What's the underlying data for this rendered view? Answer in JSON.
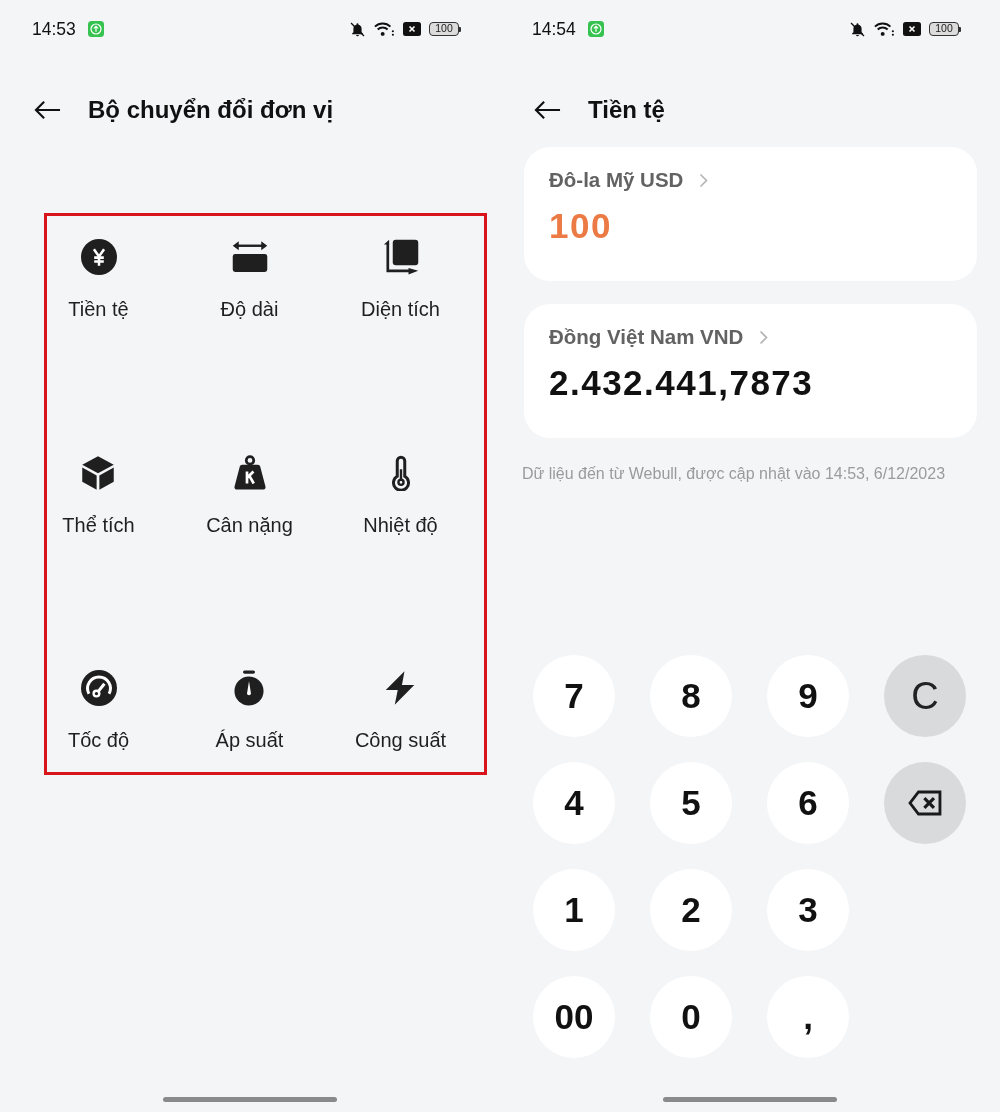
{
  "list_screen": {
    "status_bar": {
      "time": "14:53",
      "battery": "100"
    },
    "title": "Bộ chuyển đổi đơn vị",
    "categories": {
      "highlighted": true,
      "items": [
        {
          "label": "Tiền tệ"
        },
        {
          "label": "Độ dài"
        },
        {
          "label": "Diện tích"
        },
        {
          "label": "Thể tích"
        },
        {
          "label": "Cân nặng"
        },
        {
          "label": "Nhiệt độ"
        },
        {
          "label": "Tốc độ"
        },
        {
          "label": "Áp suất"
        },
        {
          "label": "Công suất"
        }
      ]
    }
  },
  "currency_screen": {
    "status_bar": {
      "time": "14:54",
      "battery": "100"
    },
    "title": "Tiền tệ",
    "currencies": [
      {
        "name": "Đô-la Mỹ USD",
        "amount": "100",
        "selected": true
      },
      {
        "name": "Đồng Việt Nam VND",
        "amount": "2.432.441,7873",
        "selected": false
      }
    ],
    "source_note": "Dữ liệu đến từ Webull, được cập nhật vào 14:53, 6/12/2023",
    "keypad": {
      "rows": [
        [
          {
            "kind": "digit",
            "label": "7"
          },
          {
            "kind": "digit",
            "label": "8"
          },
          {
            "kind": "digit",
            "label": "9"
          },
          {
            "kind": "clear",
            "label": "C"
          }
        ],
        [
          {
            "kind": "digit",
            "label": "4"
          },
          {
            "kind": "digit",
            "label": "5"
          },
          {
            "kind": "digit",
            "label": "6"
          },
          {
            "kind": "backspace"
          }
        ],
        [
          {
            "kind": "digit",
            "label": "1"
          },
          {
            "kind": "digit",
            "label": "2"
          },
          {
            "kind": "digit",
            "label": "3"
          }
        ],
        [
          {
            "kind": "digit",
            "label": "00"
          },
          {
            "kind": "digit",
            "label": "0"
          },
          {
            "kind": "digit",
            "label": ","
          }
        ]
      ]
    }
  }
}
